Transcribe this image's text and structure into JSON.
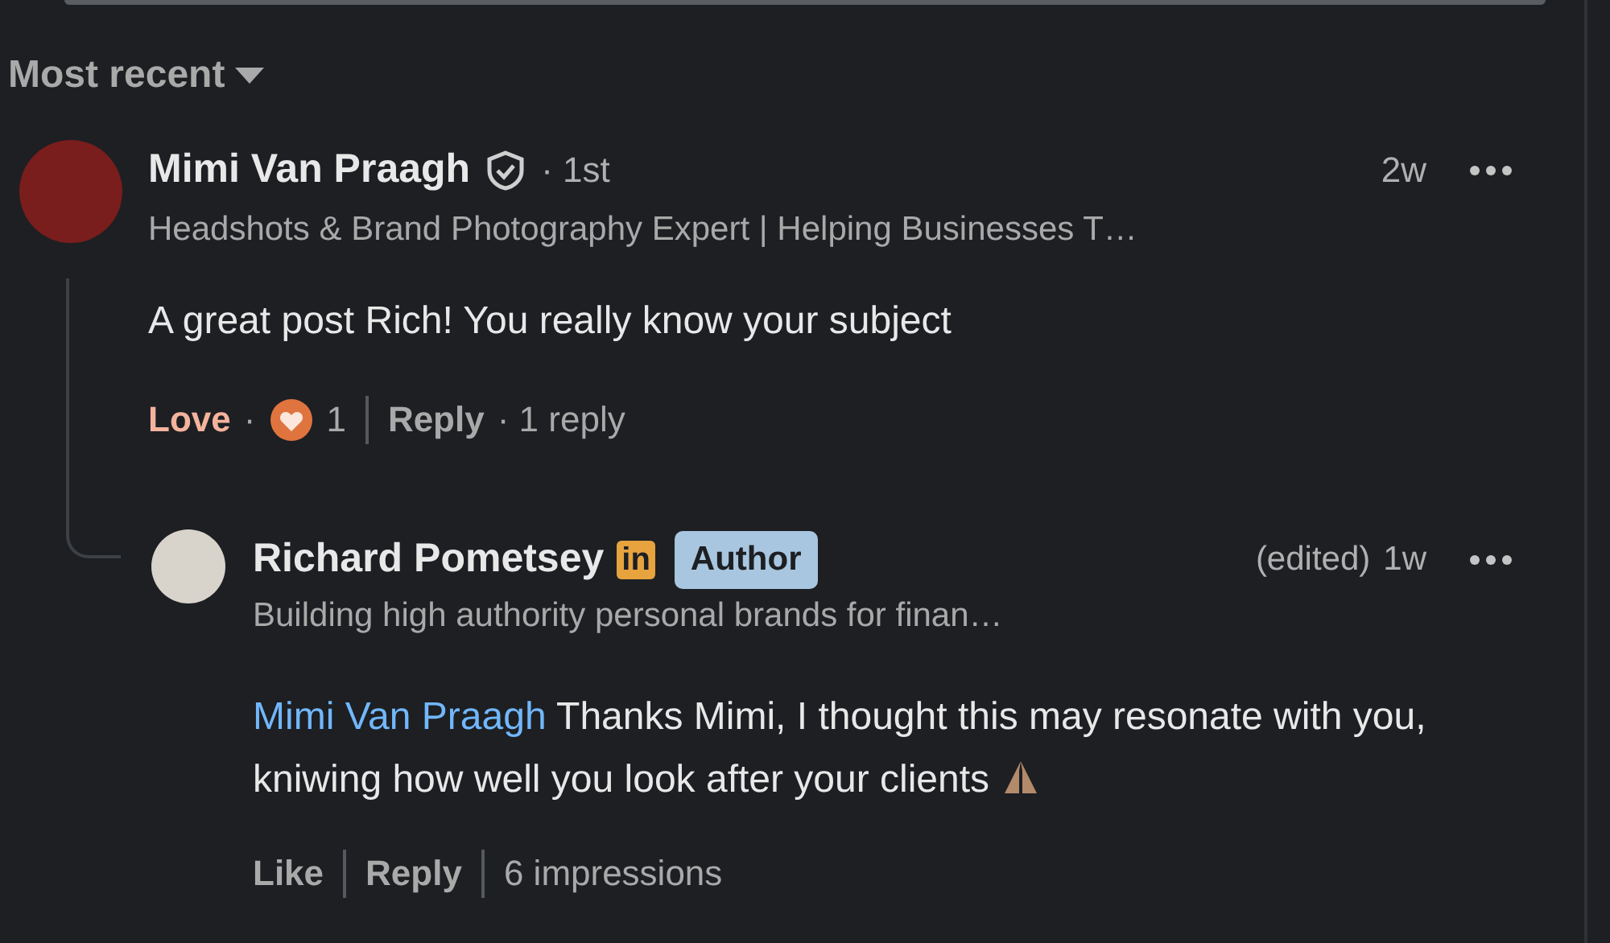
{
  "sort": {
    "label": "Most recent"
  },
  "comment": {
    "author": "Mimi Van Praagh",
    "verified": true,
    "degree": "· 1st",
    "headline": "Headshots & Brand Photography Expert | Helping Businesses T…",
    "time": "2w",
    "text": "A great post Rich! You really know your subject",
    "reaction": {
      "label": "Love",
      "separator": "·",
      "reacted": true,
      "count": "1"
    },
    "reply_label": "Reply",
    "reply_count": "· 1 reply"
  },
  "reply": {
    "author": "Richard Pometsey",
    "premium_badge": "in",
    "role_badge": "Author",
    "headline": "Building high authority personal brands for finan…",
    "edited": "(edited)",
    "time": "1w",
    "mention": "Mimi Van Praagh",
    "text": "Thanks Mimi, I thought this may resonate with you, kniwing how well you look after your clients",
    "emoji": true,
    "like": {
      "label": "Like",
      "liked": false
    },
    "reply_label": "Reply",
    "impressions": "6 impressions"
  }
}
